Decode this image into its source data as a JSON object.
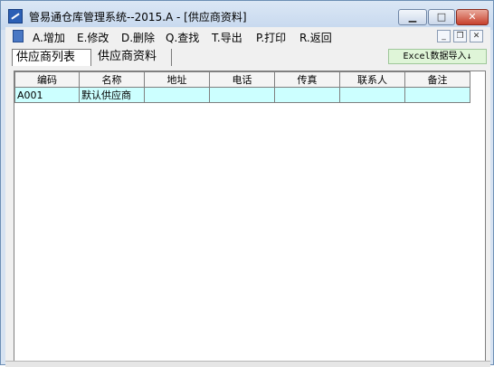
{
  "window": {
    "title": "管易通仓库管理系统--2015.A - [供应商资料]",
    "min_glyph": "▁",
    "max_glyph": "□",
    "close_glyph": "✕",
    "icon": "app-logo-icon"
  },
  "menu": {
    "icon": "document-icon",
    "items": [
      "A.增加",
      "E.修改",
      "D.删除",
      "Q.查找",
      "T.导出",
      "P.打印",
      "R.返回"
    ],
    "mdi_min": "_",
    "mdi_restore": "❐",
    "mdi_close": "✕"
  },
  "tabs": [
    {
      "label": "供应商列表",
      "active": true
    },
    {
      "label": "供应商资料",
      "active": false
    }
  ],
  "excel_button": "Excel数据导入↓",
  "table": {
    "columns": [
      "编码",
      "名称",
      "地址",
      "电话",
      "传真",
      "联系人",
      "备注"
    ],
    "rows": [
      [
        "A001",
        "默认供应商",
        "",
        "",
        "",
        "",
        ""
      ]
    ],
    "row_color": "#ccffff"
  }
}
